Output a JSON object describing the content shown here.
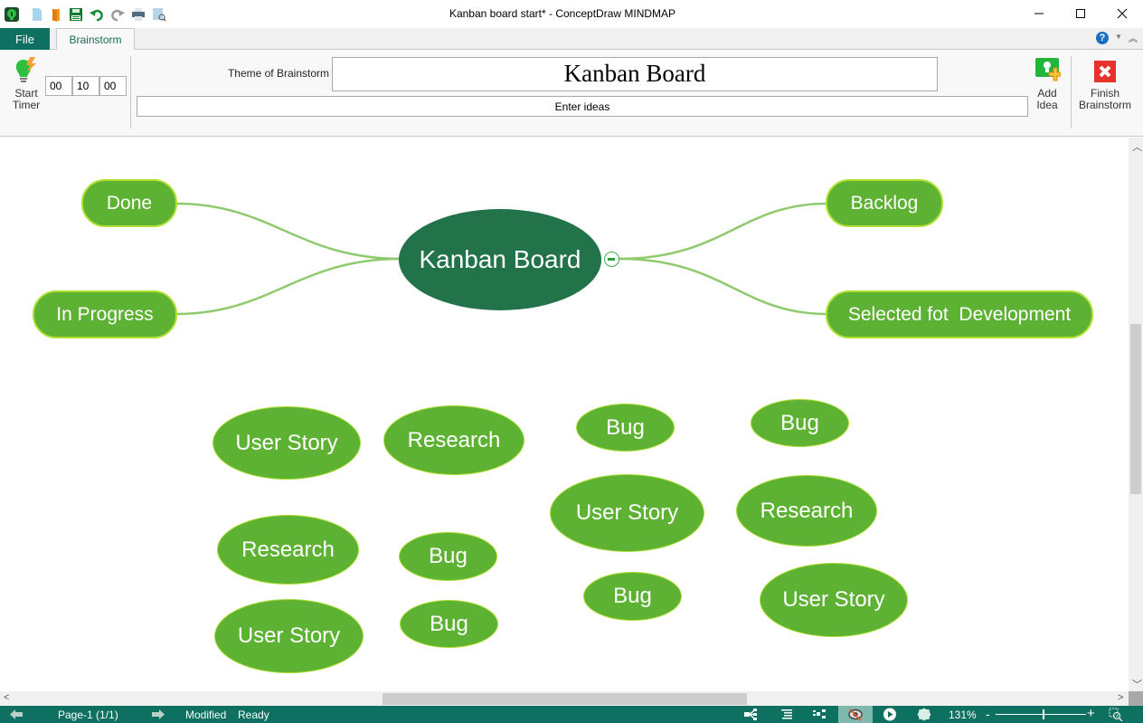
{
  "window": {
    "title": "Kanban board start* - ConceptDraw MINDMAP",
    "quick_access": [
      "app-logo-icon",
      "new-doc-icon",
      "open-icon",
      "save-icon",
      "undo-icon",
      "redo-icon",
      "print-icon",
      "print-preview-icon"
    ],
    "controls": [
      "minimize",
      "maximize",
      "close"
    ]
  },
  "ribbon": {
    "tabs": [
      {
        "label": "File",
        "active": false
      },
      {
        "label": "Brainstorm",
        "active": true
      }
    ],
    "start_timer": {
      "line1": "Start",
      "line2": "Timer"
    },
    "timer": {
      "hours": "00",
      "minutes": "10",
      "seconds": "00"
    },
    "theme_label": "Theme of Brainstorm",
    "theme_value": "Kanban Board",
    "ideas_placeholder": "Enter ideas",
    "add_idea": {
      "line1": "Add",
      "line2": "Idea"
    },
    "finish": {
      "line1": "Finish",
      "line2": "Brainstorm"
    }
  },
  "map": {
    "central": "Kanban Board",
    "branches": [
      {
        "label": "Done",
        "side": "left"
      },
      {
        "label": "In Progress",
        "side": "left"
      },
      {
        "label": "Backlog",
        "side": "right"
      },
      {
        "label": "Selected fot  Development",
        "side": "right"
      }
    ],
    "floating_topics": [
      {
        "label": "User Story"
      },
      {
        "label": "Research"
      },
      {
        "label": "Bug"
      },
      {
        "label": "Bug"
      },
      {
        "label": "User Story"
      },
      {
        "label": "Research"
      },
      {
        "label": "Research"
      },
      {
        "label": "Bug"
      },
      {
        "label": "Bug"
      },
      {
        "label": "User Story"
      },
      {
        "label": "Bug"
      },
      {
        "label": "User Story"
      }
    ],
    "colors": {
      "central_fill": "#22734a",
      "topic_fill": "#5db234",
      "topic_border": "#aee02e",
      "connector": "#8fca6e"
    }
  },
  "statusbar": {
    "page": "Page-1 (1/1)",
    "modified": "Modified",
    "ready": "Ready",
    "zoom": "131%",
    "zoom_slider_percent": 52,
    "icons": [
      "mindmap-view-icon",
      "outline-view-icon",
      "hierarchy-view-icon",
      "hide-topics-icon",
      "presentation-play-icon",
      "theme-icon"
    ]
  }
}
